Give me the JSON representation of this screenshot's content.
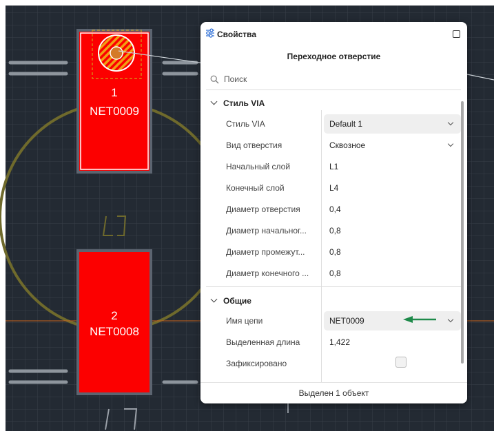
{
  "canvas": {
    "pads": [
      {
        "number": "1",
        "net": "NET0009"
      },
      {
        "number": "2",
        "net": "NET0008"
      }
    ],
    "silk_label_1": "L",
    "silk_label_2": "L",
    "colors": {
      "background": "#232a33",
      "pad": "#fc0000",
      "grid": "#39404a",
      "silkscreen": "#6f6a2c"
    }
  },
  "panel": {
    "title": "Свойства",
    "object_title": "Переходное отверстие",
    "search_placeholder": "Поиск",
    "sections": [
      {
        "name": "Стиль VIA",
        "props": [
          {
            "label": "Стиль VIA",
            "value": "Default 1",
            "dropdown": true
          },
          {
            "label": "Вид отверстия",
            "value": "Сквозное",
            "dropdown": true
          },
          {
            "label": "Начальный слой",
            "value": "L1"
          },
          {
            "label": "Конечный слой",
            "value": "L4"
          },
          {
            "label": "Диаметр отверстия",
            "value": "0,4"
          },
          {
            "label": "Диаметр начальног...",
            "value": "0,8"
          },
          {
            "label": "Диаметр промежут...",
            "value": "0,8"
          },
          {
            "label": "Диаметр конечного ...",
            "value": "0,8"
          }
        ]
      },
      {
        "name": "Общие",
        "props": [
          {
            "label": "Имя цепи",
            "value": "NET0009",
            "dropdown": true
          },
          {
            "label": "Выделенная длина",
            "value": "1,422"
          },
          {
            "label": "Зафиксировано",
            "checkbox": false
          }
        ]
      }
    ],
    "footer": "Выделен 1 объект",
    "annotation_arrow_color": "#1e8a4a"
  }
}
